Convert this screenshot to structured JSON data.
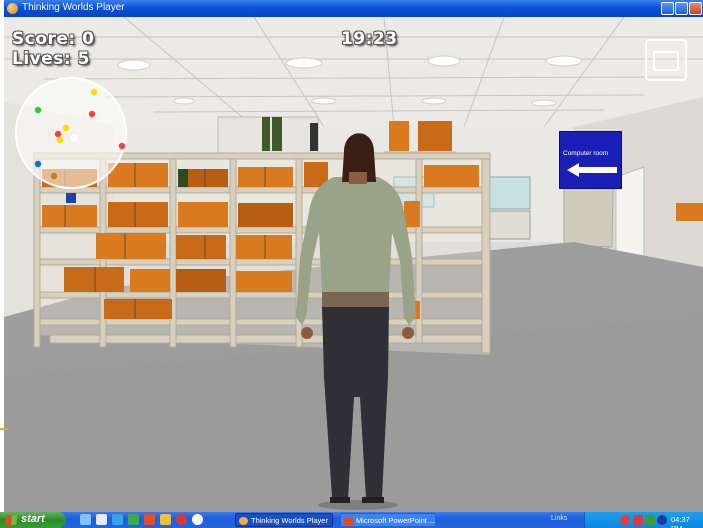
{
  "window": {
    "title": "Thinking Worlds Player"
  },
  "hud": {
    "score_label": "Score:",
    "score_value": "0",
    "lives_label": "Lives:",
    "lives_value": "5",
    "timer": "19:23"
  },
  "sign": {
    "text": "Computer room",
    "icon": "arrow-left-icon"
  },
  "minimap": {
    "dots": [
      {
        "color": "#2ecc40"
      },
      {
        "color": "#ffdc00"
      },
      {
        "color": "#ff4136"
      },
      {
        "color": "#ffdc00"
      },
      {
        "color": "#ff4136"
      },
      {
        "color": "#ffffff"
      },
      {
        "color": "#ffdc00"
      },
      {
        "color": "#ff4136"
      },
      {
        "color": "#0074d9"
      },
      {
        "color": "#c08020"
      }
    ]
  },
  "taskbar": {
    "start_label": "start",
    "tasks": [
      {
        "label": "Thinking Worlds Player",
        "icon": "game-app-icon"
      },
      {
        "label": "Microsoft PowerPoint ...",
        "icon": "powerpoint-icon"
      }
    ],
    "tray": {
      "links_label": "Links",
      "clock": "04:37 PM"
    }
  },
  "colors": {
    "titlebar": "#0a52d8",
    "taskbar": "#2464dc",
    "sign": "#1a1fb8",
    "book_orange": "#d97a1e"
  }
}
